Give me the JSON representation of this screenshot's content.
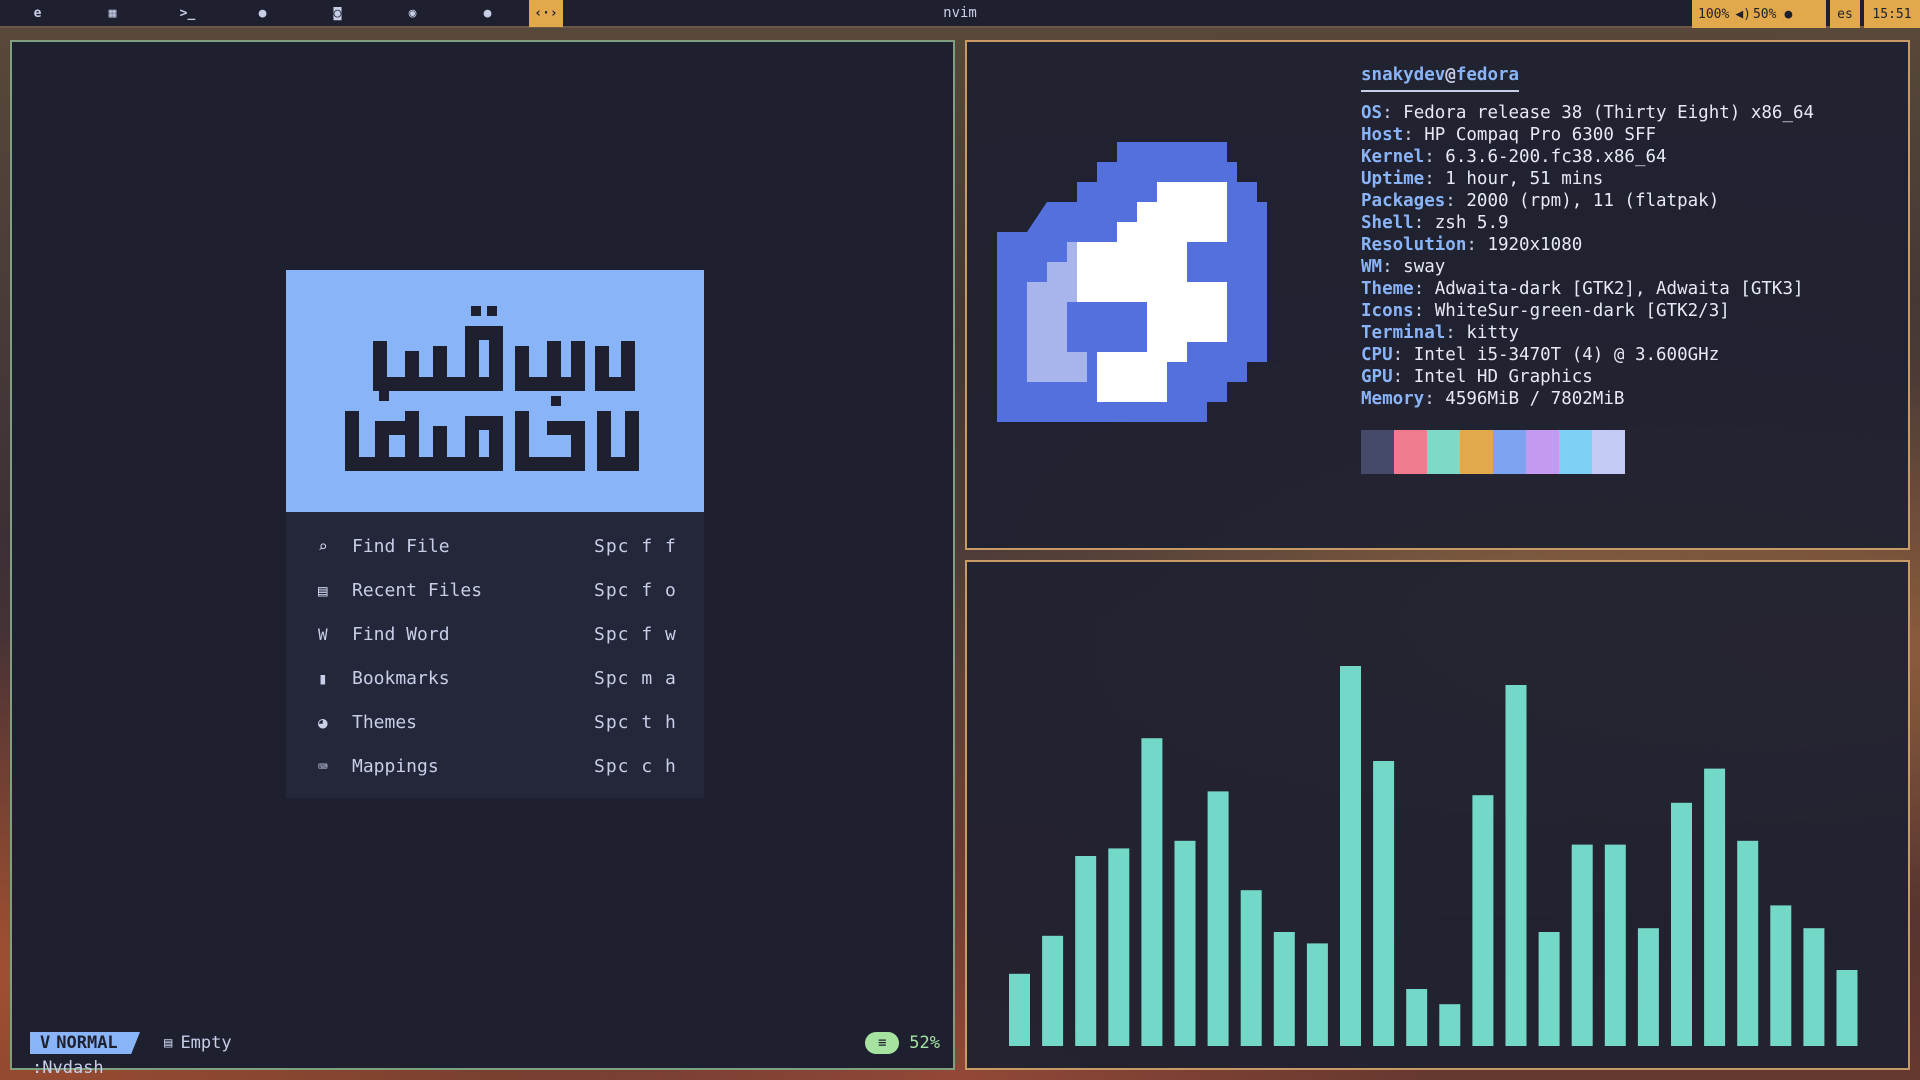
{
  "topbar": {
    "workspaces": [
      {
        "icon": "edge-icon",
        "glyph": "e",
        "focused": false
      },
      {
        "icon": "calendar-icon",
        "glyph": "▦",
        "focused": false
      },
      {
        "icon": "terminal-icon",
        "glyph": ">_",
        "focused": false
      },
      {
        "icon": "droplet-icon",
        "glyph": "●",
        "focused": false
      },
      {
        "icon": "discord-icon",
        "glyph": "◙",
        "focused": false
      },
      {
        "icon": "spotify-icon",
        "glyph": "◉",
        "focused": false
      },
      {
        "icon": "circle-icon",
        "glyph": "●",
        "focused": false
      },
      {
        "icon": "code-icon",
        "glyph": "‹·›",
        "focused": true
      }
    ],
    "window_title": "nvim",
    "brightness": "100%",
    "volume": "50%",
    "language": "es",
    "clock": "15:51"
  },
  "nvim": {
    "menu": [
      {
        "icon": "search-icon",
        "glyph": "⌕",
        "label": "Find File",
        "key": "Spc f f"
      },
      {
        "icon": "file-icon",
        "glyph": "▤",
        "label": "Recent Files",
        "key": "Spc f o"
      },
      {
        "icon": "word-icon",
        "glyph": "W",
        "label": "Find Word",
        "key": "Spc f w"
      },
      {
        "icon": "bookmark-icon",
        "glyph": "▮",
        "label": "Bookmarks",
        "key": "Spc m a"
      },
      {
        "icon": "palette-icon",
        "glyph": "◕",
        "label": "Themes",
        "key": "Spc t h"
      },
      {
        "icon": "keyboard-icon",
        "glyph": "⌨",
        "label": "Mappings",
        "key": "Spc c h"
      }
    ],
    "status": {
      "mode": "NORMAL",
      "buffer": "Empty",
      "scroll": "52%"
    },
    "cmdline": ":Nvdash"
  },
  "fetch": {
    "user": "snakydev",
    "at": "@",
    "host": "fedora",
    "rows": [
      {
        "k": "OS",
        "v": "Fedora release 38 (Thirty Eight) x86_64"
      },
      {
        "k": "Host",
        "v": "HP Compaq Pro 6300 SFF"
      },
      {
        "k": "Kernel",
        "v": "6.3.6-200.fc38.x86_64"
      },
      {
        "k": "Uptime",
        "v": "1 hour, 51 mins"
      },
      {
        "k": "Packages",
        "v": "2000 (rpm), 11 (flatpak)"
      },
      {
        "k": "Shell",
        "v": "zsh 5.9"
      },
      {
        "k": "Resolution",
        "v": "1920x1080"
      },
      {
        "k": "WM",
        "v": "sway"
      },
      {
        "k": "Theme",
        "v": "Adwaita-dark [GTK2], Adwaita [GTK3]"
      },
      {
        "k": "Icons",
        "v": "WhiteSur-green-dark [GTK2/3]"
      },
      {
        "k": "Terminal",
        "v": "kitty"
      },
      {
        "k": "CPU",
        "v": "Intel i5-3470T (4) @ 3.600GHz"
      },
      {
        "k": "GPU",
        "v": "Intel HD Graphics"
      },
      {
        "k": "Memory",
        "v": "4596MiB / 7802MiB"
      }
    ],
    "palette": [
      "#454a6a",
      "#f07b8e",
      "#7ed9c6",
      "#e2a84c",
      "#7ea3f0",
      "#c49af0",
      "#7fd0f5",
      "#c3cbf5"
    ]
  },
  "visualizer": {
    "color": "#74d8c8",
    "levels": [
      0.19,
      0.29,
      0.5,
      0.52,
      0.81,
      0.54,
      0.67,
      0.41,
      0.3,
      0.27,
      1.0,
      0.75,
      0.15,
      0.11,
      0.66,
      0.95,
      0.3,
      0.53,
      0.53,
      0.31,
      0.64,
      0.73,
      0.54,
      0.37,
      0.31,
      0.2
    ]
  }
}
